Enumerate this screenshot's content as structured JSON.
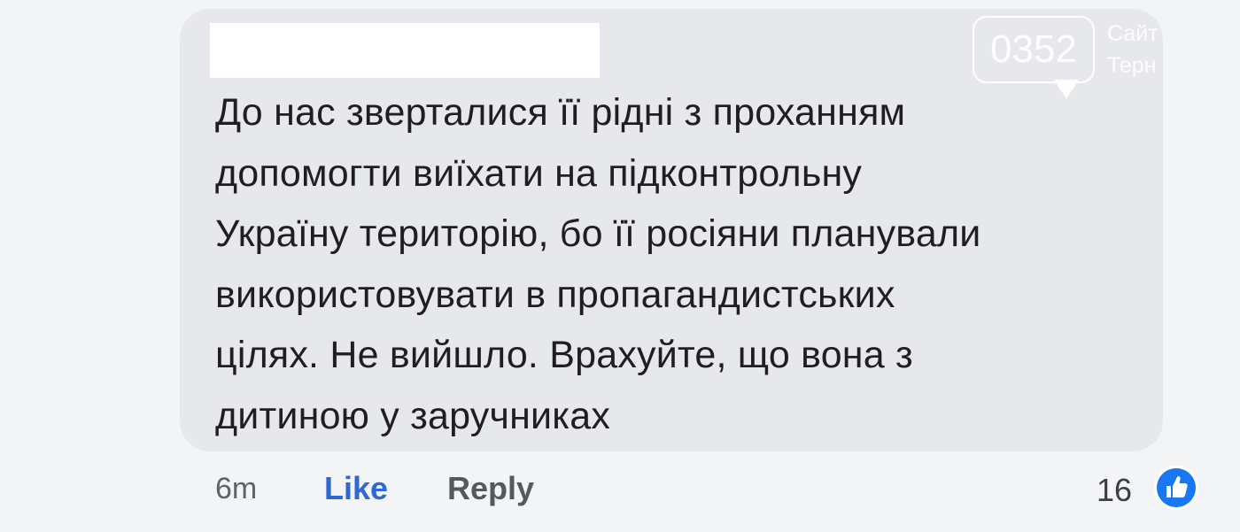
{
  "watermark": {
    "number": "0352",
    "line1": "Сайт",
    "line2": "Терн"
  },
  "comment": {
    "text": "До нас зверталися її рідні з проханням\nдопомогти виїхати на підконтрольну\nУкраїну територію, бо її росіяни планували\nвикористовувати в пропагандистських\nцілях. Не вийшло. Врахуйте, що вона з\nдитиною у заручниках"
  },
  "actions": {
    "timestamp": "6m",
    "like_label": "Like",
    "reply_label": "Reply",
    "reaction_count": "16",
    "like_color": "#2f67d4"
  },
  "icons": {
    "reaction": "thumbs-up-icon"
  }
}
